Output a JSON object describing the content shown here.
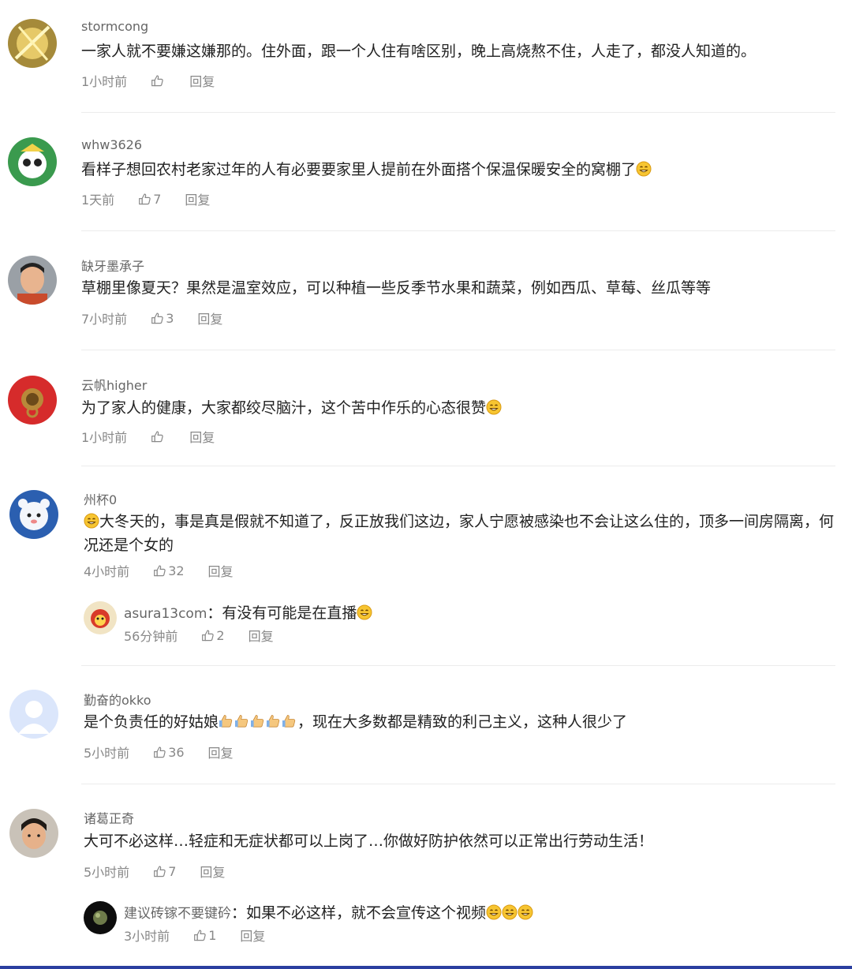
{
  "comments": [
    {
      "user": "stormcong",
      "text": "一家人就不要嫌这嫌那的。住外面，跟一个人住有啥区别，晚上高烧熬不住，人走了，都没人知道的。",
      "time": "1小时前",
      "likes": "",
      "reply": "回复"
    },
    {
      "user": "whw3626",
      "text": "看样子想回农村老家过年的人有必要要家里人提前在外面搭个保温保暖安全的窝棚了",
      "time": "1天前",
      "likes": "7",
      "reply": "回复"
    },
    {
      "user": "缺牙墨承子",
      "text": "草棚里像夏天？果然是温室效应，可以种植一些反季节水果和蔬菜，例如西瓜、草莓、丝瓜等等",
      "time": "7小时前",
      "likes": "3",
      "reply": "回复"
    },
    {
      "user": "云帆higher",
      "text": "为了家人的健康，大家都绞尽脑汁，这个苦中作乐的心态很赞",
      "time": "1小时前",
      "likes": "",
      "reply": "回复"
    },
    {
      "user": "州杯0",
      "text": "大冬天的，事是真是假就不知道了，反正放我们这边，家人宁愿被感染也不会让这么住的，顶多一间房隔离，何况还是个女的",
      "time": "4小时前",
      "likes": "32",
      "reply": "回复",
      "sub": {
        "user": "asura13com",
        "sep": "：",
        "text": "有没有可能是在直播",
        "time": "56分钟前",
        "likes": "2",
        "reply": "回复"
      }
    },
    {
      "user": "勤奋的okko",
      "text": "是个负责任的好姑娘",
      "text2": "，现在大多数都是精致的利己主义，这种人很少了",
      "time": "5小时前",
      "likes": "36",
      "reply": "回复"
    },
    {
      "user": "诸葛正奇",
      "text": "大可不必这样…轻症和无症状都可以上岗了…你做好防护依然可以正常出行劳动生活！",
      "time": "5小时前",
      "likes": "7",
      "reply": "回复",
      "sub": {
        "user": "建议砖镓不要键砛",
        "sep": "：",
        "text": "如果不必这样，就不会宣传这个视频",
        "time": "3小时前",
        "likes": "1",
        "reply": "回复"
      }
    }
  ],
  "colors": {
    "bottom_bar": "#2b3fa0",
    "emoji": "#f7c531"
  }
}
